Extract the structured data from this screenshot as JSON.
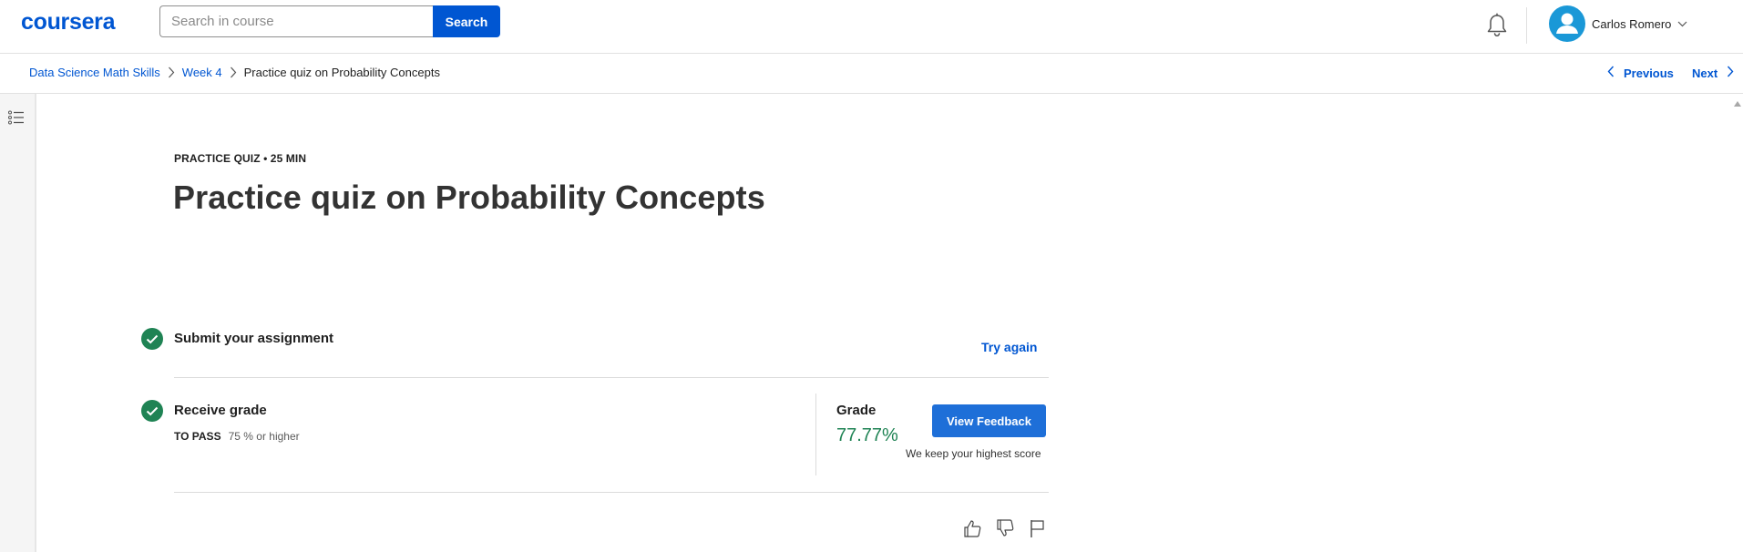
{
  "header": {
    "logo": "coursera",
    "search": {
      "placeholder": "Search in course",
      "value": "",
      "button_label": "Search"
    },
    "notifications_icon": "bell-icon",
    "user": {
      "name": "Carlos Romero",
      "avatar_icon": "user-avatar-icon"
    }
  },
  "breadcrumb": {
    "items": [
      {
        "label": "Data Science Math Skills",
        "link": true
      },
      {
        "label": "Week 4",
        "link": true
      },
      {
        "label": "Practice quiz on Probability Concepts",
        "link": false
      }
    ],
    "previous_label": "Previous",
    "next_label": "Next"
  },
  "sidebar": {
    "toggle_icon": "list-icon"
  },
  "quiz": {
    "kicker": "PRACTICE QUIZ • 25 MIN",
    "title": "Practice quiz on Probability Concepts",
    "steps": [
      {
        "title": "Submit your assignment",
        "status": "complete",
        "action_label": "Try again"
      },
      {
        "title": "Receive grade",
        "status": "complete",
        "pass_label": "TO PASS",
        "pass_value": "75 % or higher"
      }
    ],
    "grade": {
      "label": "Grade",
      "value": "77.77%",
      "feedback_button": "View Feedback",
      "note": "We keep your highest score"
    },
    "feedback_icons": [
      "like-icon",
      "dislike-icon",
      "flag-icon"
    ]
  },
  "colors": {
    "brand": "#0056d2",
    "success": "#1f8354",
    "button": "#1e6fd8"
  }
}
